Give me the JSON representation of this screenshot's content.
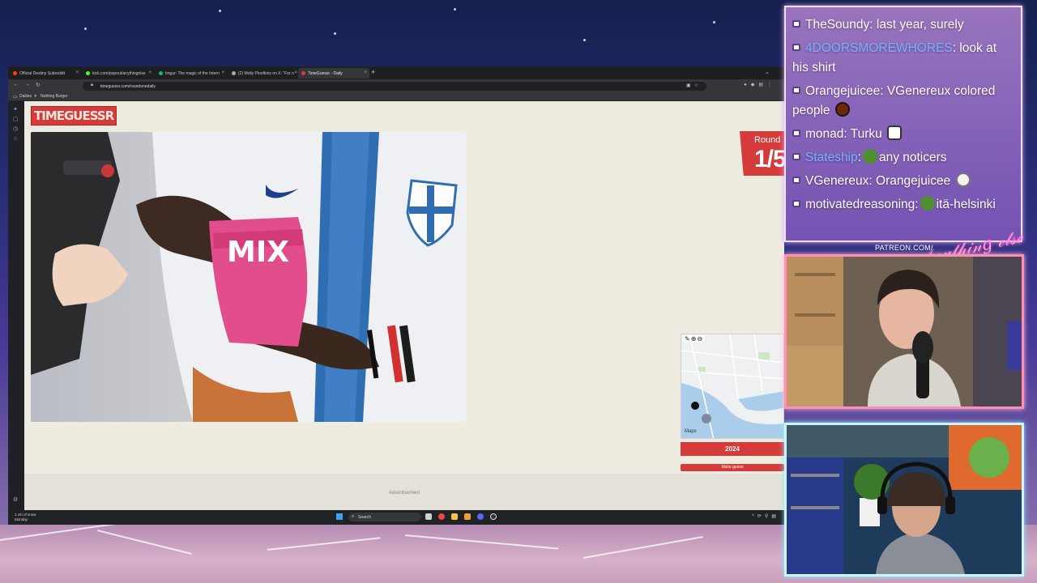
{
  "browser": {
    "tabs": [
      {
        "title": "Official Destiny Subreddit",
        "fav_color": "#ff4500",
        "active": false
      },
      {
        "title": "kick.com/popout/anythingelse",
        "fav_color": "#53fc18",
        "active": false
      },
      {
        "title": "Imgur: The magic of the Intern",
        "fav_color": "#1bb76e",
        "active": false
      },
      {
        "title": "(2) Molly Ploofkins on X: \"For n",
        "fav_color": "#aaaaaa",
        "active": false
      },
      {
        "title": "TimeGuessr - Daily",
        "fav_color": "#d63b3b",
        "active": true
      }
    ],
    "url": "timeguessr.com/roundonedaily",
    "bookmarks": [
      "Dailies",
      "Nothing Burger"
    ]
  },
  "page": {
    "logo": "TIMEGUESSR",
    "round_label": "Round",
    "round_value": "1/5",
    "year": "2024",
    "make_guess": "Make guess",
    "advertisement": "Advertisement",
    "map_credit": "Maps",
    "photo_text": "MIX"
  },
  "taskbar": {
    "weather_temp": "1 cm of snow",
    "weather_day": "Monday",
    "search": "Search"
  },
  "chat": {
    "messages": [
      {
        "user": "TheSoundy",
        "text": "last year, surely",
        "user_color": "white"
      },
      {
        "user": "4DOORSMOREWHORES",
        "text": "look at his shirt",
        "user_color": "blue"
      },
      {
        "user": "Orangejuicee",
        "text": "VGenereux colored people",
        "user_color": "white",
        "emote": "ball"
      },
      {
        "user": "monad",
        "text": "Turku",
        "user_color": "white",
        "emote": "cat"
      },
      {
        "user": "Stateship",
        "text": "any noticers",
        "user_color": "blue",
        "emote": "pepe"
      },
      {
        "user": "VGenereux",
        "text": "Orangejuicee",
        "user_color": "white",
        "emote": "skull"
      },
      {
        "user": "motivatedreasoning",
        "text": "itä-helsinki",
        "user_color": "white",
        "emote": "pepe"
      }
    ]
  },
  "overlay": {
    "patreon": "PATREON.COM/",
    "signature": "AnythingElse"
  },
  "colors": {
    "accent": "#d63b3b",
    "page_bg": "#eeebe1",
    "chat_border": "#f2dcff"
  }
}
